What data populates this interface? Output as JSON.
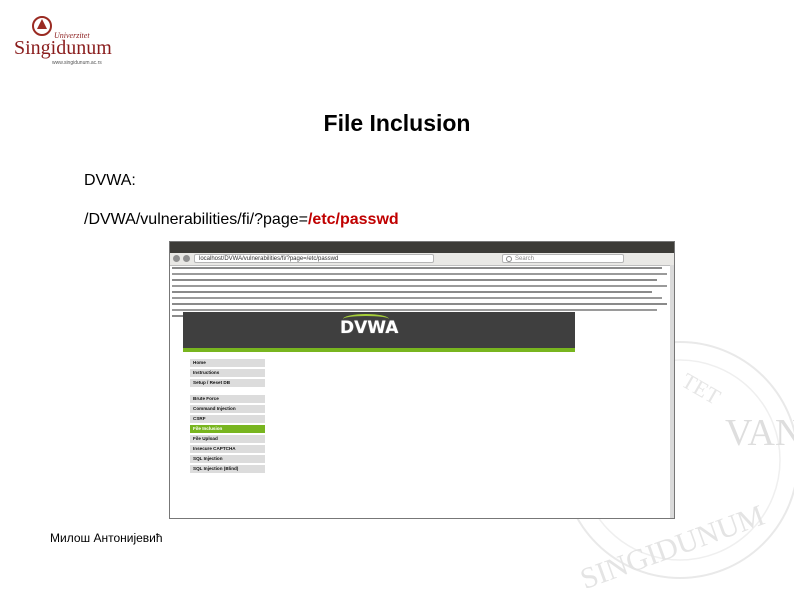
{
  "slide": {
    "title": "File Inclusion",
    "line1": "DVWA:",
    "url_prefix": "/DVWA/vulnerabilities/fi/?page=",
    "url_param": "/etc/passwd",
    "author": "Милош Антонијевић"
  },
  "logo": {
    "university_word": "Univerzitet",
    "name": "Singidunum",
    "site": "www.singidunum.ac.rs"
  },
  "seal": {
    "text": "ANIVERSITET SINGIDUNUM VANI"
  },
  "browser": {
    "url": "localhost/DVWA/vulnerabilities/fi/?page=/etc/passwd",
    "search_placeholder": "Search"
  },
  "dvwa": {
    "logo": "DVWA",
    "menu": [
      {
        "label": "Home",
        "active": false
      },
      {
        "label": "Instructions",
        "active": false
      },
      {
        "label": "Setup / Reset DB",
        "active": false
      },
      {
        "label": "Brute Force",
        "active": false
      },
      {
        "label": "Command Injection",
        "active": false
      },
      {
        "label": "CSRF",
        "active": false
      },
      {
        "label": "File Inclusion",
        "active": true
      },
      {
        "label": "File Upload",
        "active": false
      },
      {
        "label": "Insecure CAPTCHA",
        "active": false
      },
      {
        "label": "SQL Injection",
        "active": false
      },
      {
        "label": "SQL Injection (Blind)",
        "active": false
      }
    ]
  },
  "colors": {
    "accent_red": "#c00000",
    "dvwa_green": "#78b51f",
    "dvwa_dark": "#3f3f3f"
  }
}
